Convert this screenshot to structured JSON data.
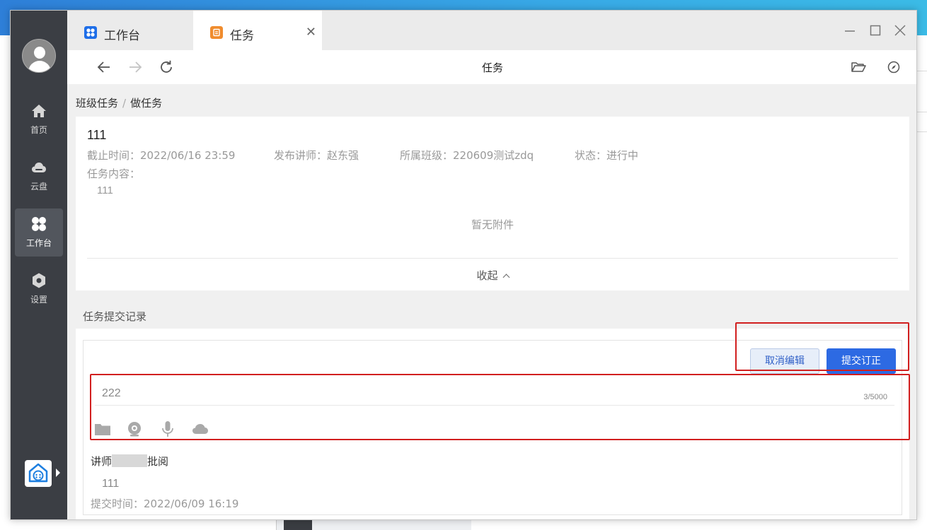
{
  "window": {
    "tabs": [
      {
        "label": "工作台",
        "icon": "grid-app-icon",
        "color": "#1e6ee8"
      },
      {
        "label": "任务",
        "icon": "task-icon",
        "color": "#f08c2e"
      }
    ]
  },
  "sidebar": {
    "items": [
      {
        "label": "首页",
        "icon": "home-icon"
      },
      {
        "label": "云盘",
        "icon": "cloud-icon"
      },
      {
        "label": "工作台",
        "icon": "workbench-icon",
        "active": true
      },
      {
        "label": "设置",
        "icon": "settings-icon"
      }
    ]
  },
  "addressbar": {
    "page_name": "任务"
  },
  "breadcrumb": [
    "班级任务",
    "做任务"
  ],
  "task": {
    "title": "111",
    "deadline": "截止时间：2022/06/16 23:59",
    "teacher": "发布讲师：赵东强",
    "class": "所属班级：220609测试zdq",
    "status": "状态：进行中",
    "content_label": "任务内容：",
    "content": "111",
    "no_attachment": "暂无附件",
    "collapse": "收起"
  },
  "records": {
    "title": "任务提交记录",
    "cancel_button": "取消编辑",
    "submit_button": "提交订正",
    "editor_text": "222",
    "char_count": "3/5000",
    "reviewer_prefix": "讲师",
    "reviewer_suffix": "批阅",
    "reply": "111",
    "submit_time": "提交时间：2022/06/09 16:19"
  },
  "colors": {
    "accent": "#2d6ae3",
    "highlight": "#d11f1f",
    "sidebar": "#3b3e44"
  }
}
